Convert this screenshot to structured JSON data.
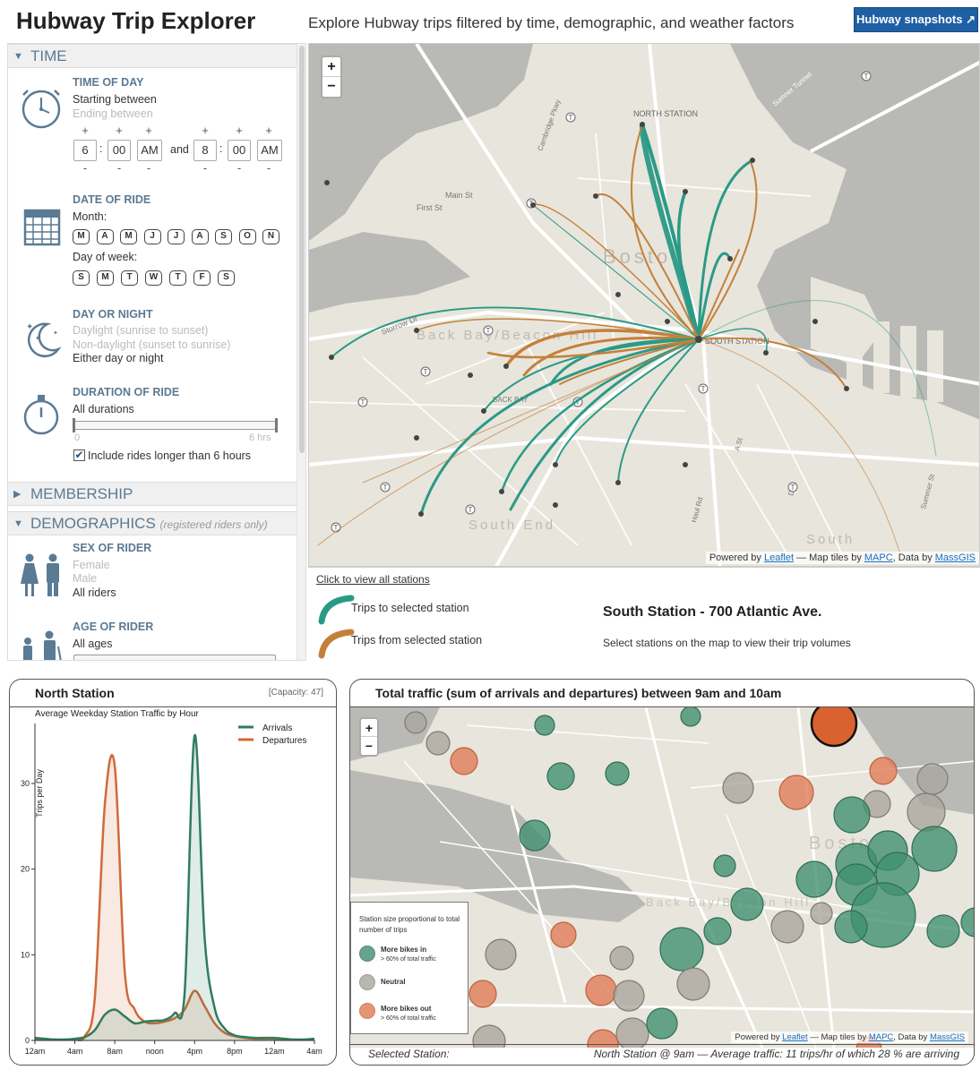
{
  "header": {
    "title": "Hubway Trip Explorer",
    "tagline": "Explore Hubway trips filtered by time, demographic, and weather factors",
    "snapshots_button": "Hubway snapshots ↗"
  },
  "sidebar": {
    "time": {
      "label": "TIME",
      "time_of_day": {
        "title": "TIME OF DAY",
        "starting": "Starting between",
        "ending": "Ending between",
        "start": {
          "hour": "6",
          "minute": "00",
          "ampm": "AM"
        },
        "and_label": "and",
        "end": {
          "hour": "8",
          "minute": "00",
          "ampm": "AM"
        },
        "plus": "+",
        "minus": "-"
      },
      "date_of_ride": {
        "title": "DATE OF RIDE",
        "month_label": "Month:",
        "months": [
          "M",
          "A",
          "M",
          "J",
          "J",
          "A",
          "S",
          "O",
          "N"
        ],
        "dow_label": "Day of week:",
        "days": [
          "S",
          "M",
          "T",
          "W",
          "T",
          "F",
          "S"
        ]
      },
      "day_or_night": {
        "title": "DAY OR NIGHT",
        "options": [
          "Daylight (sunrise to sunset)",
          "Non-daylight (sunset to sunrise)",
          "Either day or night"
        ]
      },
      "duration": {
        "title": "DURATION OF RIDE",
        "value": "All durations",
        "min": "0",
        "max": "6 hrs",
        "include_long": "Include rides longer than 6 hours"
      }
    },
    "membership": {
      "label": "MEMBERSHIP"
    },
    "demographics": {
      "label": "DEMOGRAPHICS",
      "note": "(registered riders only)",
      "sex": {
        "title": "SEX OF RIDER",
        "options": [
          "Female",
          "Male",
          "All riders"
        ]
      },
      "age": {
        "title": "AGE OF RIDER",
        "value": "All ages"
      }
    }
  },
  "map_top": {
    "zoom_in": "+",
    "zoom_out": "−",
    "labels": {
      "north_station": "NORTH STATION",
      "south_station": "SOUTH STATION",
      "main_st": "Main St",
      "first_st": "First St",
      "storrow": "Storrow Dr",
      "back_bay": "BACK BAY",
      "boston": "Bosto",
      "back_bay_hill": "Back Bay/Beacon Hill",
      "south_end": "South End",
      "south": "South",
      "cambridge_pkwy": "Cambridge Pkwy",
      "a_st": "A St",
      "d_st": "D St",
      "haul_rd": "Haul Rd",
      "summer_st": "Summer St",
      "sumner_tunnel": "Sumner Tunnel"
    },
    "attribution": {
      "prefix": "Powered by",
      "leaflet": "Leaflet",
      "mid": "— Map tiles by",
      "mapc": "MAPC",
      "data": ", Data by",
      "massgis": "MassGIS"
    }
  },
  "legend_top": {
    "view_all": "Click to view all stations",
    "to_label": "Trips to selected station",
    "from_label": "Trips from selected station",
    "station_name": "South Station - 700 Atlantic Ave.",
    "hint": "Select stations on the map to view their trip volumes",
    "to_color": "#2a9a86",
    "from_color": "#c4803a"
  },
  "north_panel": {
    "title": "North Station",
    "capacity": "[Capacity: 47]",
    "subtitle": "Average Weekday Station Traffic by Hour",
    "y_title": "Trips per Day"
  },
  "traffic_panel": {
    "title": "Total traffic (sum of arrivals and departures) between 9am and 10am",
    "legend": {
      "title": "Station size proportional to total number of trips",
      "in_label": "More bikes in",
      "in_sub": "> 60% of total traffic",
      "neutral_label": "Neutral",
      "out_label": "More bikes out",
      "out_sub": "> 60% of total traffic",
      "in_color": "#3f8f6f",
      "neutral_color": "#a9a59e",
      "out_color": "#e07a55"
    },
    "selected_label": "Selected Station:",
    "selected_value": "North Station @ 9am — Average traffic: 11 trips/hr of which 28 % are arriving"
  },
  "chart_data": {
    "type": "area",
    "x": [
      "12am",
      "1am",
      "2am",
      "3am",
      "4am",
      "5am",
      "6am",
      "7am",
      "8am",
      "9am",
      "10am",
      "11am",
      "noon",
      "1pm",
      "2pm",
      "3pm",
      "4pm",
      "5pm",
      "6pm",
      "7pm",
      "8pm",
      "9pm",
      "10pm",
      "11pm",
      "12am",
      "1am",
      "2am",
      "3am",
      "4am"
    ],
    "x_ticks": [
      "12am",
      "4am",
      "8am",
      "noon",
      "4pm",
      "8pm",
      "12am",
      "4am"
    ],
    "series": [
      {
        "name": "Arrivals",
        "color": "#2f7d5e",
        "values": [
          0.3,
          0.2,
          0.1,
          0.1,
          0.2,
          0.4,
          1.2,
          3.0,
          3.6,
          2.8,
          2.0,
          2.2,
          2.3,
          2.4,
          3.2,
          5.6,
          35.6,
          12.0,
          3.8,
          1.4,
          0.6,
          0.4,
          0.3,
          0.3,
          0.3,
          0.2,
          0.1,
          0.1,
          0.2
        ]
      },
      {
        "name": "Departures",
        "color": "#d06a3a",
        "values": [
          0.2,
          0.1,
          0.1,
          0.1,
          0.1,
          0.5,
          5.0,
          27.5,
          32.0,
          8.0,
          3.6,
          2.2,
          2.0,
          2.2,
          2.6,
          3.6,
          5.8,
          4.0,
          2.0,
          0.9,
          0.5,
          0.3,
          0.2,
          0.2,
          0.2,
          0.1,
          0.1,
          0.1,
          0.1
        ]
      }
    ],
    "ylim": [
      0,
      37
    ],
    "y_ticks": [
      0,
      10,
      20,
      30
    ],
    "ylabel": "Trips per Day",
    "title": "Average Weekday Station Traffic by Hour"
  }
}
